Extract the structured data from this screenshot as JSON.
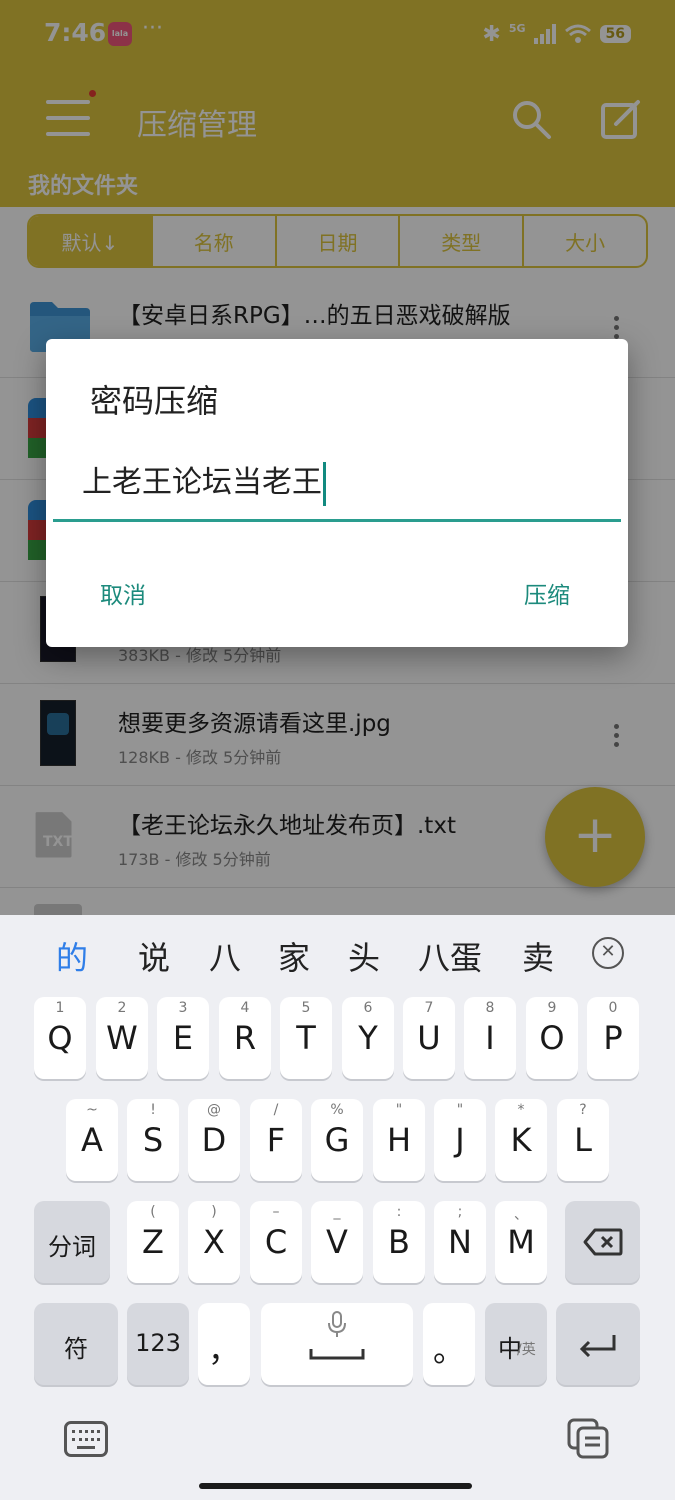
{
  "status_bar": {
    "time": "7:46",
    "notif_app_label": "lala",
    "more_dots": "···",
    "network": "5G",
    "battery": "56"
  },
  "app_bar": {
    "title": "压缩管理",
    "folder_title": "我的文件夹"
  },
  "sort_tabs": [
    "默认↓",
    "名称",
    "日期",
    "类型",
    "大小"
  ],
  "files": [
    {
      "name": "【安卓日系RPG】…的五日恶戏破解版",
      "meta": "",
      "icon": "folder-icon"
    },
    {
      "name": "",
      "meta": "",
      "icon": "rar-archive-icon"
    },
    {
      "name": "",
      "meta": "",
      "icon": "rar-archive-icon"
    },
    {
      "name": "",
      "meta": "383KB - 修改 5分钟前",
      "icon": "image-thumbnail-icon"
    },
    {
      "name": "想要更多资源请看这里.jpg",
      "meta": "128KB - 修改 5分钟前",
      "icon": "image-thumbnail-icon"
    },
    {
      "name": "【老王论坛永久地址发布页】.txt",
      "meta": "173B - 修改 5分钟前",
      "icon": "txt-file-icon"
    }
  ],
  "txt_icon_label": "TXT",
  "fab_label": "+",
  "dialog": {
    "title": "密码压缩",
    "input_value": "上老王论坛当老王",
    "cancel_label": "取消",
    "confirm_label": "压缩"
  },
  "keyboard": {
    "candidates": [
      "的",
      "说",
      "八",
      "家",
      "头",
      "八蛋",
      "卖"
    ],
    "row1": [
      {
        "hint": "1",
        "key": "Q"
      },
      {
        "hint": "2",
        "key": "W"
      },
      {
        "hint": "3",
        "key": "E"
      },
      {
        "hint": "4",
        "key": "R"
      },
      {
        "hint": "5",
        "key": "T"
      },
      {
        "hint": "6",
        "key": "Y"
      },
      {
        "hint": "7",
        "key": "U"
      },
      {
        "hint": "8",
        "key": "I"
      },
      {
        "hint": "9",
        "key": "O"
      },
      {
        "hint": "0",
        "key": "P"
      }
    ],
    "row2": [
      {
        "hint": "~",
        "key": "A"
      },
      {
        "hint": "!",
        "key": "S"
      },
      {
        "hint": "@",
        "key": "D"
      },
      {
        "hint": "/",
        "key": "F"
      },
      {
        "hint": "%",
        "key": "G"
      },
      {
        "hint": "\"",
        "key": "H"
      },
      {
        "hint": "\"",
        "key": "J"
      },
      {
        "hint": "*",
        "key": "K"
      },
      {
        "hint": "?",
        "key": "L"
      }
    ],
    "row3": [
      {
        "hint": "(",
        "key": "Z"
      },
      {
        "hint": ")",
        "key": "X"
      },
      {
        "hint": "–",
        "key": "C"
      },
      {
        "hint": "_",
        "key": "V"
      },
      {
        "hint": ":",
        "key": "B"
      },
      {
        "hint": ";",
        "key": "N"
      },
      {
        "hint": "、",
        "key": "M"
      }
    ],
    "segment_key": "分词",
    "symbol_key": "符",
    "number_key": "123",
    "comma_key": "，",
    "period_key": "。",
    "lang_key_main": "中",
    "lang_key_sub": "/英"
  }
}
